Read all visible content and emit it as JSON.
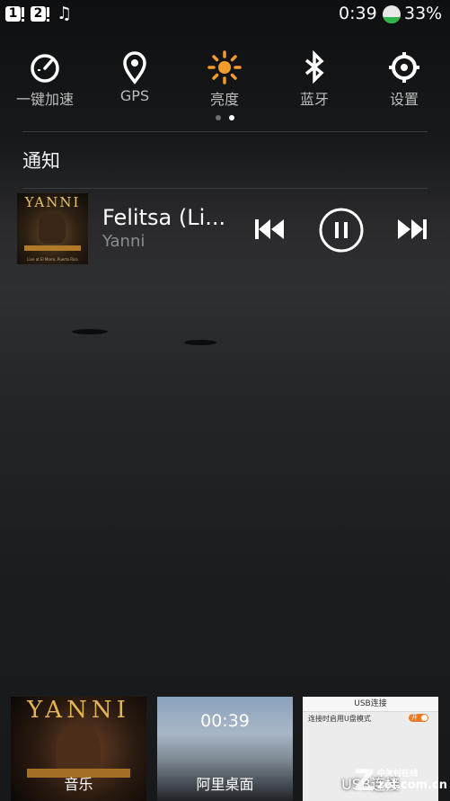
{
  "status_bar": {
    "sim1": "1",
    "sim2": "2",
    "time": "0:39",
    "battery": "33%",
    "battery_level": 0.33,
    "music_icon": "music-note-icon"
  },
  "quick_settings": [
    {
      "label": "一键加速",
      "icon": "speedometer-icon"
    },
    {
      "label": "GPS",
      "icon": "location-pin-icon"
    },
    {
      "label": "亮度",
      "icon": "brightness-sun-icon",
      "color": "#f39c2c"
    },
    {
      "label": "蓝牙",
      "icon": "bluetooth-icon"
    },
    {
      "label": "设置",
      "icon": "gear-icon"
    }
  ],
  "page_indicator": {
    "pages": 2,
    "current": 2
  },
  "notifications": {
    "title": "通知",
    "media": {
      "album_art_text": "YANNI",
      "album_art_subtext": "Live at El Morro, Puerto Rico",
      "song": "Felitsa (Li...",
      "artist": "Yanni",
      "controls": [
        "previous-icon",
        "pause-icon",
        "next-icon"
      ]
    }
  },
  "recent_apps": [
    {
      "label": "音乐",
      "art_text": "YANNI"
    },
    {
      "label": "阿里桌面",
      "clock": "00:39"
    },
    {
      "label": "USB连接",
      "header": "USB连接",
      "row": "连接时启用U盘模式",
      "toggle": "开"
    }
  ],
  "watermark": {
    "cn": "中关村在线",
    "url": "zol.com.cn"
  },
  "colors": {
    "accent": "#f39c2c",
    "battery_green": "#2fb64a"
  }
}
